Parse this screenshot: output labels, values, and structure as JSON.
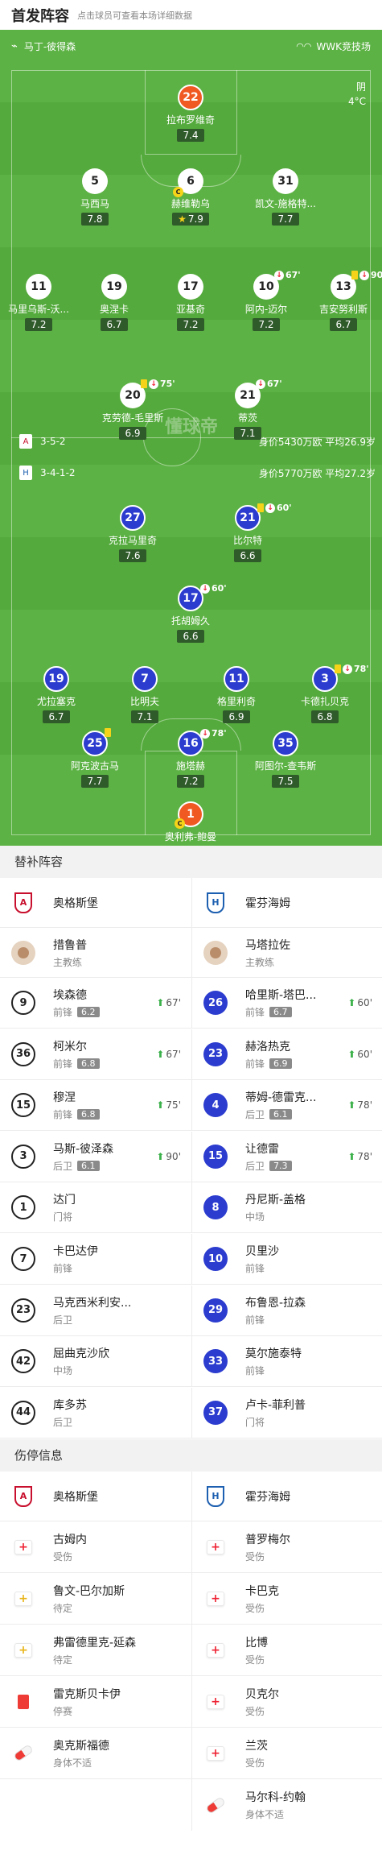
{
  "header": {
    "title": "首发阵容",
    "subtitle": "点击球员可查看本场详细数据"
  },
  "pitch": {
    "referee": "马丁-彼得森",
    "source": "WWK竞技场",
    "weather": "阴",
    "temperature": "4°C",
    "watermark": "懂球帝",
    "home": {
      "formation": "3-5-2",
      "info": "身价5430万欧 平均26.9岁",
      "color": "#ffffff"
    },
    "away": {
      "formation": "3-4-1-2",
      "info": "身价5770万欧 平均27.2岁",
      "color": "#2b3ccf"
    }
  },
  "home_players": [
    {
      "num": "22",
      "name": "拉布罗维奇",
      "rating": "7.4",
      "kind": "o"
    },
    {
      "num": "5",
      "name": "马西马",
      "rating": "7.8",
      "kind": "w"
    },
    {
      "num": "6",
      "name": "赫维勒乌",
      "rating": "7.9",
      "kind": "w",
      "captain": "C",
      "star": "★"
    },
    {
      "num": "31",
      "name": "凯文-施格特...",
      "rating": "7.7",
      "kind": "w"
    },
    {
      "num": "11",
      "name": "马里乌斯-沃...",
      "rating": "7.2",
      "kind": "w"
    },
    {
      "num": "19",
      "name": "奥涅卡",
      "rating": "6.7",
      "kind": "w"
    },
    {
      "num": "17",
      "name": "亚基奇",
      "rating": "7.2",
      "kind": "w"
    },
    {
      "num": "10",
      "name": "阿内-迈尔",
      "rating": "7.2",
      "kind": "w",
      "sub": "67'"
    },
    {
      "num": "13",
      "name": "吉安努利斯",
      "rating": "6.7",
      "kind": "w",
      "yellow": true,
      "sub": "90'"
    },
    {
      "num": "20",
      "name": "克劳德-毛里斯",
      "rating": "6.9",
      "kind": "w",
      "yellow": true,
      "sub": "75'"
    },
    {
      "num": "21",
      "name": "蒂茨",
      "rating": "7.1",
      "kind": "w",
      "sub": "67'"
    }
  ],
  "away_players": [
    {
      "num": "27",
      "name": "克拉马里奇",
      "rating": "7.6",
      "kind": "b"
    },
    {
      "num": "21",
      "name": "比尔特",
      "rating": "6.6",
      "kind": "b",
      "yellow": true,
      "sub": "60'"
    },
    {
      "num": "17",
      "name": "托胡姆久",
      "rating": "6.6",
      "kind": "b",
      "sub": "60'"
    },
    {
      "num": "19",
      "name": "尤拉塞克",
      "rating": "6.7",
      "kind": "b"
    },
    {
      "num": "7",
      "name": "比明夫",
      "rating": "7.1",
      "kind": "b"
    },
    {
      "num": "11",
      "name": "格里利奇",
      "rating": "6.9",
      "kind": "b"
    },
    {
      "num": "3",
      "name": "卡德扎贝克",
      "rating": "6.8",
      "kind": "b",
      "yellow": true,
      "sub": "78'"
    },
    {
      "num": "25",
      "name": "阿克波古马",
      "rating": "7.7",
      "kind": "b",
      "yellow": true
    },
    {
      "num": "16",
      "name": "施塔赫",
      "rating": "7.2",
      "kind": "b",
      "sub": "78'"
    },
    {
      "num": "35",
      "name": "阿图尔-查韦斯",
      "rating": "7.5",
      "kind": "b"
    },
    {
      "num": "1",
      "name": "奥利弗-鲍曼",
      "rating": "7.4",
      "kind": "o",
      "captain": "C"
    }
  ],
  "subs": {
    "title": "替补阵容",
    "home_team": "奥格斯堡",
    "away_team": "霍芬海姆",
    "home_coach": {
      "name": "措鲁普",
      "role": "主教练"
    },
    "away_coach": {
      "name": "马塔拉佐",
      "role": "主教练"
    },
    "home": [
      {
        "num": "9",
        "name": "埃森德",
        "pos": "前锋",
        "rating": "6.2",
        "time": "67'"
      },
      {
        "num": "36",
        "name": "柯米尔",
        "pos": "前锋",
        "rating": "6.8",
        "time": "67'"
      },
      {
        "num": "15",
        "name": "穆涅",
        "pos": "前锋",
        "rating": "6.8",
        "time": "75'"
      },
      {
        "num": "3",
        "name": "马斯-彼泽森",
        "pos": "后卫",
        "rating": "6.1",
        "time": "90'"
      },
      {
        "num": "1",
        "name": "达门",
        "pos": "门将"
      },
      {
        "num": "7",
        "name": "卡巴达伊",
        "pos": "前锋"
      },
      {
        "num": "23",
        "name": "马克西米利安...",
        "pos": "后卫"
      },
      {
        "num": "42",
        "name": "屈曲克沙欣",
        "pos": "中场"
      },
      {
        "num": "44",
        "name": "库多苏",
        "pos": "后卫"
      }
    ],
    "away": [
      {
        "num": "26",
        "name": "哈里斯-塔巴...",
        "pos": "前锋",
        "rating": "6.7",
        "time": "60'"
      },
      {
        "num": "23",
        "name": "赫洛热克",
        "pos": "前锋",
        "rating": "6.9",
        "time": "60'"
      },
      {
        "num": "4",
        "name": "蒂姆-德雷克...",
        "pos": "后卫",
        "rating": "6.1",
        "time": "78'"
      },
      {
        "num": "15",
        "name": "让德雷",
        "pos": "后卫",
        "rating": "7.3",
        "time": "78'"
      },
      {
        "num": "8",
        "name": "丹尼斯-盖格",
        "pos": "中场"
      },
      {
        "num": "10",
        "name": "贝里沙",
        "pos": "前锋"
      },
      {
        "num": "29",
        "name": "布鲁恩-拉森",
        "pos": "前锋"
      },
      {
        "num": "33",
        "name": "莫尔施泰特",
        "pos": "前锋"
      },
      {
        "num": "37",
        "name": "卢卡-菲利普",
        "pos": "门将"
      }
    ]
  },
  "injuries": {
    "title": "伤停信息",
    "home_team": "奥格斯堡",
    "away_team": "霍芬海姆",
    "home": [
      {
        "name": "古姆内",
        "status": "受伤",
        "icon": "injury-icon"
      },
      {
        "name": "鲁文-巴尔加斯",
        "status": "待定",
        "icon": "doubtful-icon"
      },
      {
        "name": "弗雷德里克-延森",
        "status": "待定",
        "icon": "doubtful-icon"
      },
      {
        "name": "雷克斯贝卡伊",
        "status": "停赛",
        "icon": "red-card-icon"
      },
      {
        "name": "奥克斯福德",
        "status": "身体不适",
        "icon": "illness-icon"
      }
    ],
    "away": [
      {
        "name": "普罗梅尔",
        "status": "受伤",
        "icon": "injury-icon"
      },
      {
        "name": "卡巴克",
        "status": "受伤",
        "icon": "injury-icon"
      },
      {
        "name": "比博",
        "status": "受伤",
        "icon": "injury-icon"
      },
      {
        "name": "贝克尔",
        "status": "受伤",
        "icon": "injury-icon"
      },
      {
        "name": "兰茨",
        "status": "受伤",
        "icon": "injury-icon"
      },
      {
        "name": "马尔科-约翰",
        "status": "身体不适",
        "icon": "illness-icon"
      }
    ]
  }
}
